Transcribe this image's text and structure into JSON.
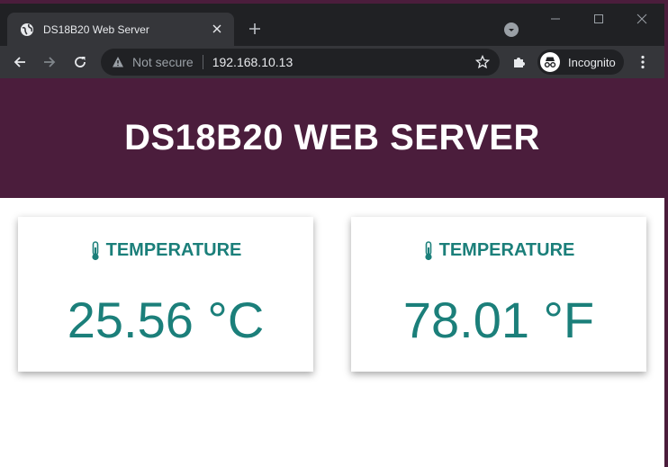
{
  "browser": {
    "tab_title": "DS18B20 Web Server",
    "security_label": "Not secure",
    "url": "192.168.10.13",
    "profile_label": "Incognito"
  },
  "page": {
    "title": "DS18B20 WEB SERVER",
    "cards": [
      {
        "label": "TEMPERATURE",
        "value": "25.56 °C"
      },
      {
        "label": "TEMPERATURE",
        "value": "78.01 °F"
      }
    ]
  },
  "colors": {
    "header_bg": "#4b1d3c",
    "accent": "#1b7f7a",
    "chrome_dark": "#202124",
    "chrome_toolbar": "#35363a"
  },
  "icons": {
    "favicon": "globe-icon",
    "tab_close": "close-icon",
    "new_tab": "plus-icon",
    "tab_search": "chevron-down-icon",
    "back": "arrow-left-icon",
    "forward": "arrow-right-icon",
    "reload": "reload-icon",
    "security": "warning-icon",
    "bookmark": "star-icon",
    "extensions": "puzzle-icon",
    "incognito": "incognito-icon",
    "menu": "kebab-menu-icon",
    "card_icon": "thermometer-icon"
  }
}
